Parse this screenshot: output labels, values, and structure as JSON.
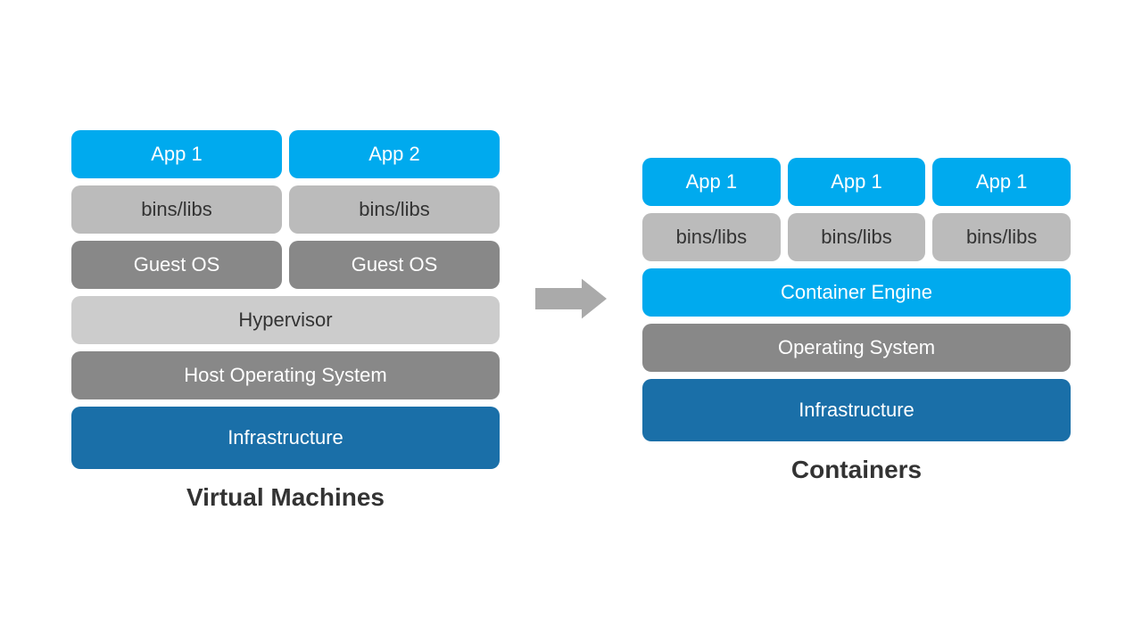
{
  "left": {
    "label": "Virtual Machines",
    "row1": {
      "app1": "App 1",
      "app2": "App 2"
    },
    "row2": {
      "bins1": "bins/libs",
      "bins2": "bins/libs"
    },
    "row3": {
      "guest1": "Guest OS",
      "guest2": "Guest OS"
    },
    "hypervisor": "Hypervisor",
    "host_os": "Host Operating System",
    "infrastructure": "Infrastructure"
  },
  "right": {
    "label": "Containers",
    "row1": {
      "app1": "App 1",
      "app2": "App 1",
      "app3": "App 1"
    },
    "row2": {
      "bins1": "bins/libs",
      "bins2": "bins/libs",
      "bins3": "bins/libs"
    },
    "container_engine": "Container Engine",
    "operating_system": "Operating System",
    "infrastructure": "Infrastructure"
  }
}
